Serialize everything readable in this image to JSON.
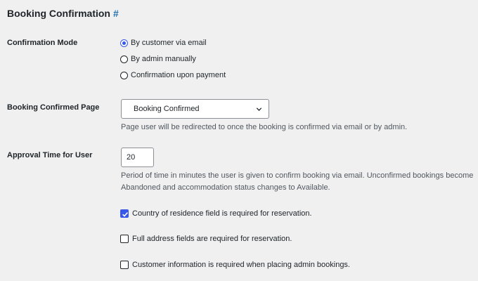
{
  "section": {
    "title": "Booking Confirmation",
    "anchor": "#"
  },
  "confirmation_mode": {
    "label": "Confirmation Mode",
    "options": [
      {
        "label": "By customer via email",
        "checked": true
      },
      {
        "label": "By admin manually",
        "checked": false
      },
      {
        "label": "Confirmation upon payment",
        "checked": false
      }
    ]
  },
  "confirmed_page": {
    "label": "Booking Confirmed Page",
    "selected": "Booking Confirmed",
    "description": "Page user will be redirected to once the booking is confirmed via email or by admin."
  },
  "approval_time": {
    "label": "Approval Time for User",
    "value": "20",
    "description_line1": "Period of time in minutes the user is given to confirm booking via email. Unconfirmed bookings become",
    "description_line2": "Abandoned and accommodation status changes to Available."
  },
  "checkboxes": [
    {
      "label": "Country of residence field is required for reservation.",
      "checked": true
    },
    {
      "label": "Full address fields are required for reservation.",
      "checked": false
    },
    {
      "label": "Customer information is required when placing admin bookings.",
      "checked": false
    }
  ],
  "colors": {
    "accent": "#3858e9",
    "link": "#2271b1",
    "background": "#f0f0f1"
  },
  "icons": {
    "select": "chevron-down-icon",
    "check": "checkmark-icon"
  }
}
